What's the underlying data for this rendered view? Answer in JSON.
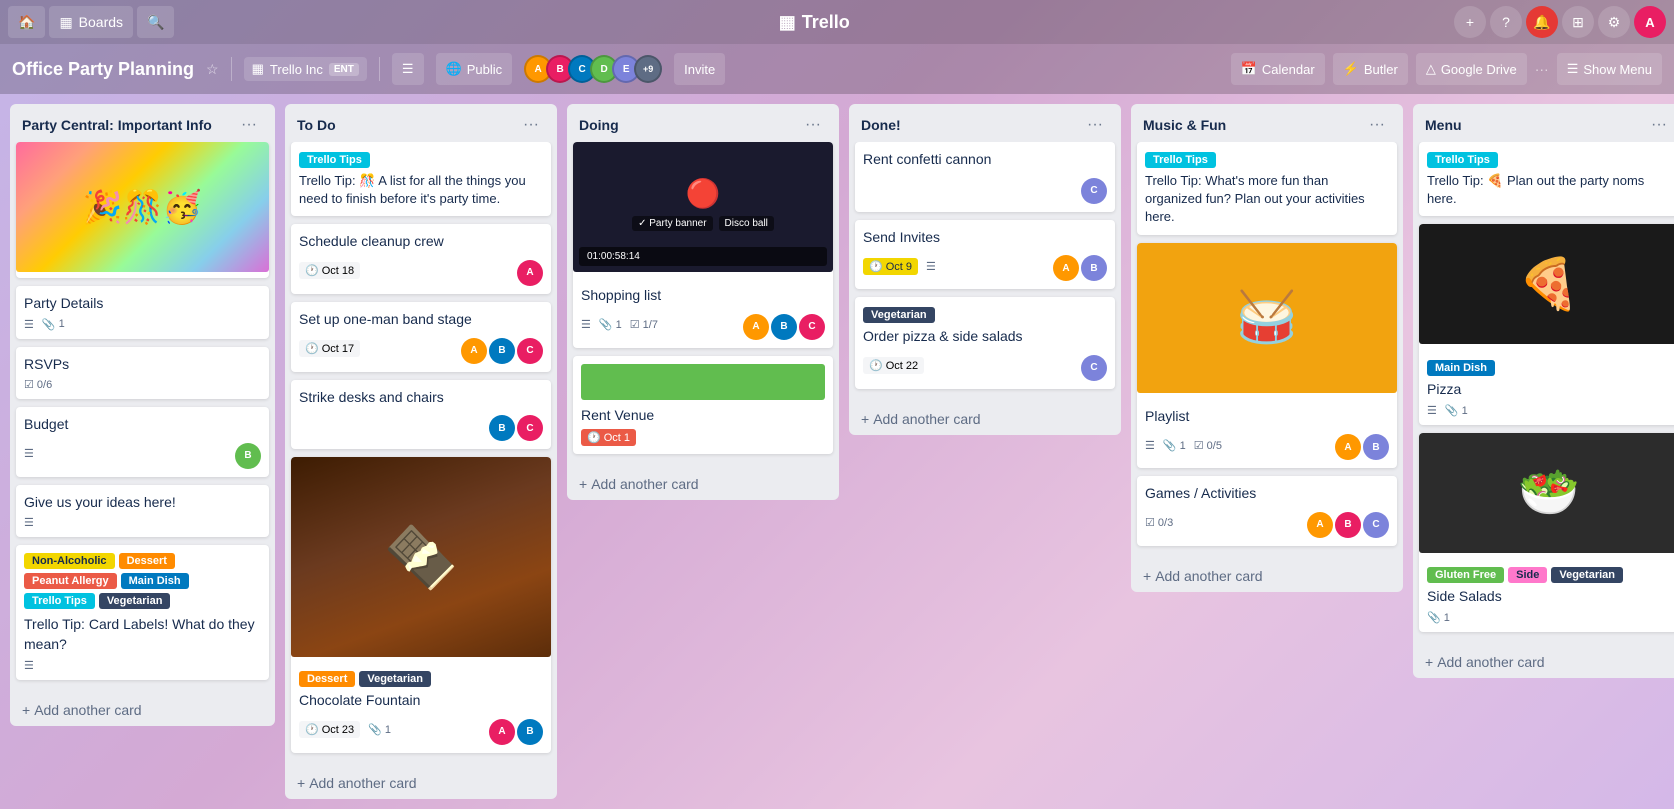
{
  "app": {
    "nav": {
      "boards_label": "Boards",
      "search_placeholder": "Search",
      "logo_text": "Trello",
      "show_menu_label": "Show Menu"
    },
    "board": {
      "title": "Office Party Planning",
      "org_name": "Trello Inc",
      "org_badge": "ENT",
      "visibility": "Public",
      "member_count": "+9",
      "invite_label": "Invite",
      "calendar_label": "Calendar",
      "butler_label": "Butler",
      "drive_label": "Google Drive"
    },
    "columns": [
      {
        "id": "party-central",
        "title": "Party Central: Important Info",
        "cards": [
          {
            "id": "party-cover",
            "type": "cover-party",
            "has_cover": true
          },
          {
            "id": "party-details",
            "title": "Party Details",
            "badges": {
              "description": true,
              "count": "1"
            }
          },
          {
            "id": "rsvps",
            "title": "RSVPs",
            "badges": {
              "checklist": "0/6"
            }
          },
          {
            "id": "budget",
            "title": "Budget",
            "badges": {
              "description": true
            },
            "has_member": true,
            "member_color": "#61bd4f"
          },
          {
            "id": "give-ideas",
            "title": "Give us your ideas here!",
            "badges": {
              "description": true
            }
          },
          {
            "id": "card-labels",
            "labels": [
              "Non-Alcoholic",
              "Dessert",
              "Peanut Allergy",
              "Main Dish",
              "Trello Tips",
              "Vegetarian"
            ],
            "label_colors": [
              "tag-yellow",
              "tag-orange",
              "tag-red",
              "tag-blue",
              "tag-teal",
              "tag-dark"
            ],
            "title": "Trello Tip: Card Labels! What do they mean?"
          }
        ],
        "add_label": "+ Add another card"
      },
      {
        "id": "to-do",
        "title": "To Do",
        "cards": [
          {
            "id": "trello-tip-todo",
            "is_tip": true,
            "tip_badge": "Trello Tips",
            "tip_text": "Trello Tip: 🎊 A list for all the things you need to finish before it's party time."
          },
          {
            "id": "cleanup-crew",
            "title": "Schedule cleanup crew",
            "date": "Oct 18",
            "has_member": true,
            "member_color": "#e91e63"
          },
          {
            "id": "one-man-band",
            "title": "Set up one-man band stage",
            "date": "Oct 17",
            "has_members": true,
            "member_colors": [
              "#ff9800",
              "#0079bf",
              "#e91e63"
            ]
          },
          {
            "id": "strike-desks",
            "title": "Strike desks and chairs",
            "has_members": true,
            "member_colors": [
              "#0079bf",
              "#e91e63"
            ]
          },
          {
            "id": "chocolate-fountain",
            "title": "Chocolate Fountain",
            "type": "cover-chocolate",
            "has_cover": true,
            "labels": [
              "Dessert",
              "Vegetarian"
            ],
            "label_colors": [
              "tag-orange",
              "tag-dark"
            ],
            "date": "Oct 23",
            "attachment_count": "1",
            "has_members": true,
            "member_colors": [
              "#e91e63",
              "#0079bf"
            ]
          }
        ],
        "add_label": "+ Add another card"
      },
      {
        "id": "doing",
        "title": "Doing",
        "cards": [
          {
            "id": "shopping-list",
            "title": "Shopping list",
            "type": "cover-video",
            "has_cover": true,
            "video_time": "01:00:58:14",
            "video_labels": [
              "Party banner",
              "Disco ball"
            ],
            "badges": {
              "description": true,
              "attachment": "1",
              "checklist": "1/7"
            },
            "has_members": true,
            "member_colors": [
              "#ff9800",
              "#0079bf",
              "#e91e63"
            ]
          },
          {
            "id": "rent-venue",
            "title": "Rent Venue",
            "date_label": "Oct 1",
            "date_type": "overdue"
          }
        ],
        "add_label": "+ Add another card"
      },
      {
        "id": "done",
        "title": "Done!",
        "cards": [
          {
            "id": "confetti-cannon",
            "title": "Rent confetti cannon",
            "has_member": true,
            "member_color": "#7c83db"
          },
          {
            "id": "send-invites",
            "title": "Send Invites",
            "date": "Oct 9",
            "date_type": "upcoming",
            "badges": {
              "description": true
            },
            "has_members": true,
            "member_colors": [
              "#ff9800",
              "#7c83db"
            ]
          },
          {
            "id": "order-pizza",
            "title": "Order pizza & side salads",
            "label": "Vegetarian",
            "label_color": "tag-dark",
            "date": "Oct 22",
            "has_member": true,
            "member_color": "#7c83db"
          }
        ],
        "add_label": "+ Add another card"
      },
      {
        "id": "music-fun",
        "title": "Music & Fun",
        "cards": [
          {
            "id": "trello-tip-music",
            "is_tip": true,
            "tip_badge": "Trello Tips",
            "tip_text": "Trello Tip: What's more fun than organized fun? Plan out your activities here."
          },
          {
            "id": "playlist",
            "type": "cover-drum",
            "has_cover": true,
            "title": "Playlist",
            "badges": {
              "description": true,
              "count": "1",
              "checklist": "0/5"
            },
            "has_members": true,
            "member_colors": [
              "#ff9800",
              "#7c83db"
            ]
          },
          {
            "id": "games-activities",
            "title": "Games / Activities",
            "badges": {
              "checklist": "0/3"
            },
            "has_members": true,
            "member_colors": [
              "#ff9800",
              "#e91e63",
              "#7c83db"
            ]
          }
        ],
        "add_label": "+ Add another card"
      },
      {
        "id": "menu",
        "title": "Menu",
        "cards": [
          {
            "id": "trello-tip-menu",
            "is_tip": true,
            "tip_badge": "Trello Tips",
            "tip_text": "Trello Tip: 🍕 Plan out the party noms here."
          },
          {
            "id": "pizza",
            "type": "cover-pizza",
            "has_cover": true,
            "title": "Pizza",
            "label": "Main Dish",
            "label_color": "tag-blue",
            "badges": {
              "description": true,
              "attachment": "1"
            }
          },
          {
            "id": "side-salads",
            "type": "cover-salad",
            "has_cover": true,
            "title": "Side Salads",
            "labels": [
              "Gluten Free",
              "Side",
              "Vegetarian"
            ],
            "label_colors": [
              "tag-green",
              "tag-pink",
              "tag-dark"
            ],
            "badges": {
              "attachment": "1"
            }
          }
        ],
        "add_label": "+ Add another card"
      }
    ]
  }
}
